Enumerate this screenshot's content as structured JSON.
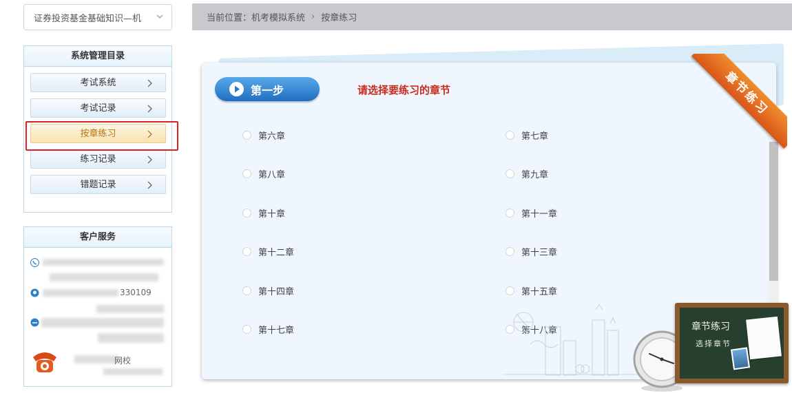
{
  "sidebar": {
    "course_select": "证券投资基金基础知识—机",
    "menu": {
      "title": "系统管理目录",
      "items": [
        {
          "label": "考试系统"
        },
        {
          "label": "考试记录"
        },
        {
          "label": "按章练习"
        },
        {
          "label": "练习记录"
        },
        {
          "label": "错题记录"
        }
      ]
    },
    "service": {
      "title": "客户服务",
      "phone_suffix": "330109",
      "school_fragment": "网校"
    }
  },
  "breadcrumb": {
    "prefix": "当前位置：",
    "parent": "机考模拟系统",
    "current": "按章练习"
  },
  "main": {
    "step_label": "第一步",
    "prompt": "请选择要练习的章节",
    "ribbon": "章节练习",
    "chapters": [
      "第六章",
      "第七章",
      "第八章",
      "第九章",
      "第十章",
      "第十一章",
      "第十二章",
      "第十三章",
      "第十四章",
      "第十五章",
      "第十七章",
      "第十八章"
    ],
    "board_title": "章节练习",
    "board_subtitle": "选择章节"
  },
  "colors": {
    "accent_blue": "#1f6fc2",
    "prompt_red": "#c82a1c",
    "highlight_red": "#e02020",
    "ribbon_orange": "#e0661f",
    "active_item_text": "#b8741a"
  }
}
